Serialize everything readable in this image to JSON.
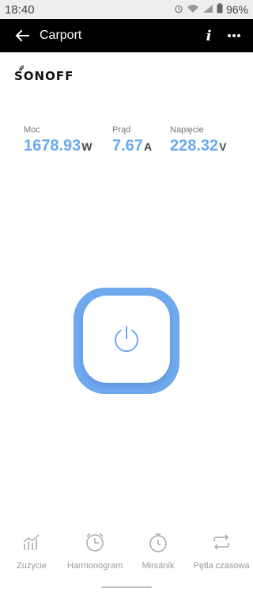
{
  "status_bar": {
    "time": "18:40",
    "battery": "96%",
    "icons": [
      "alarm-icon",
      "wifi-icon",
      "signal-icon",
      "battery-icon"
    ]
  },
  "app_bar": {
    "title": "Carport",
    "background": "#000000",
    "icons": [
      "back-arrow-icon",
      "info-icon",
      "more-icon"
    ]
  },
  "brand": {
    "logo_text": "SONOFF"
  },
  "metrics": [
    {
      "label": "Moc",
      "value": "1678.93",
      "unit": "W"
    },
    {
      "label": "Prąd",
      "value": "7.67",
      "unit": "A"
    },
    {
      "label": "Napięcie",
      "value": "228.32",
      "unit": "V"
    }
  ],
  "power_button": {
    "icon": "power-icon",
    "accent": "#70aaee"
  },
  "bottom_nav": [
    {
      "label": "Zużycie",
      "icon": "bar-chart-icon"
    },
    {
      "label": "Harmonogram",
      "icon": "alarm-clock-icon"
    },
    {
      "label": "Minutnik",
      "icon": "timer-icon"
    },
    {
      "label": "Pętla czasowa",
      "icon": "loop-icon"
    }
  ],
  "colors": {
    "value_blue": "#6aaaf0",
    "label_grey": "#777777",
    "nav_grey": "#999999"
  }
}
